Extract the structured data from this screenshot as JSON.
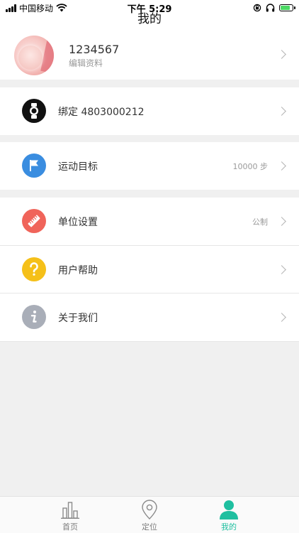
{
  "status_bar": {
    "carrier": "中国移动",
    "time": "下午 5:29"
  },
  "header": {
    "title": "我的"
  },
  "profile": {
    "user_id": "1234567",
    "edit_label": "编辑资料"
  },
  "rows": {
    "bind": {
      "label": "绑定 4803000212",
      "icon": "watch-icon",
      "color": "#111111"
    },
    "goal": {
      "label": "运动目标",
      "value": "10000 步",
      "icon": "flag-icon",
      "color": "#3a8de0"
    },
    "units": {
      "label": "单位设置",
      "value": "公制",
      "icon": "ruler-icon",
      "color": "#f0645a"
    },
    "help": {
      "label": "用户帮助",
      "icon": "question-icon",
      "color": "#f5c019"
    },
    "about": {
      "label": "关于我们",
      "icon": "info-icon",
      "color": "#a9aeb8"
    }
  },
  "tabbar": {
    "home": "首页",
    "locate": "定位",
    "mine": "我的",
    "active_color": "#1fbfa0"
  }
}
